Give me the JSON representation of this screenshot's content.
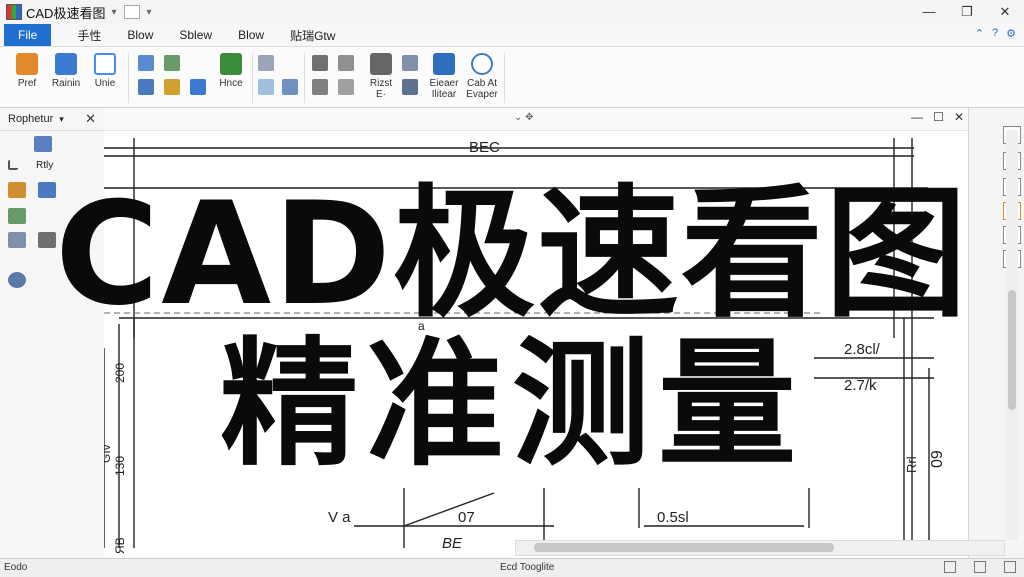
{
  "window": {
    "title": "CAD极速看图",
    "controls": {
      "minimize": "—",
      "restore": "❐",
      "close": "✕"
    }
  },
  "menu": {
    "file": "File",
    "items": [
      "手性",
      "Blow",
      "Sblew",
      "Blow",
      "贴瑞Gtw"
    ]
  },
  "ribbon": {
    "buttons": [
      {
        "label": "Pref",
        "color": "#e08a2c"
      },
      {
        "label": "Rainin",
        "color": "#3b7bd0"
      },
      {
        "label": "Unie",
        "color": "#4a8de0"
      },
      {
        "label": "Hnce",
        "color": "#3c8c3c"
      },
      {
        "label": "Rizst\nE·",
        "color": "#666666"
      },
      {
        "label": "Eieaer\nIlitear",
        "color": "#2f6fc0"
      },
      {
        "label": "Cab At\nEvaper",
        "color": "#3b7bd0"
      }
    ]
  },
  "panel": {
    "title": "Rophetur",
    "close": "✕",
    "tool_label": "Rtly"
  },
  "drawing": {
    "top_dimension": "BEC",
    "dim_a": "a",
    "dim_left_1": "200",
    "dim_left_2": "GIv",
    "dim_left_3": "130",
    "dim_left_4": "ЯB",
    "dim_right_1": "2.8cl/",
    "dim_right_2": "2.7/k",
    "dim_right_3": "09",
    "dim_right_4": "Rrl",
    "dim_va": "V a",
    "dim_07": "07",
    "dim_be": "BE",
    "dim_05": "0.5sl"
  },
  "overlay": {
    "line1": "CAD极速看图",
    "line2": "精准测量"
  },
  "status": {
    "left": "Eodo",
    "middle": "Ecd Tooglite"
  }
}
